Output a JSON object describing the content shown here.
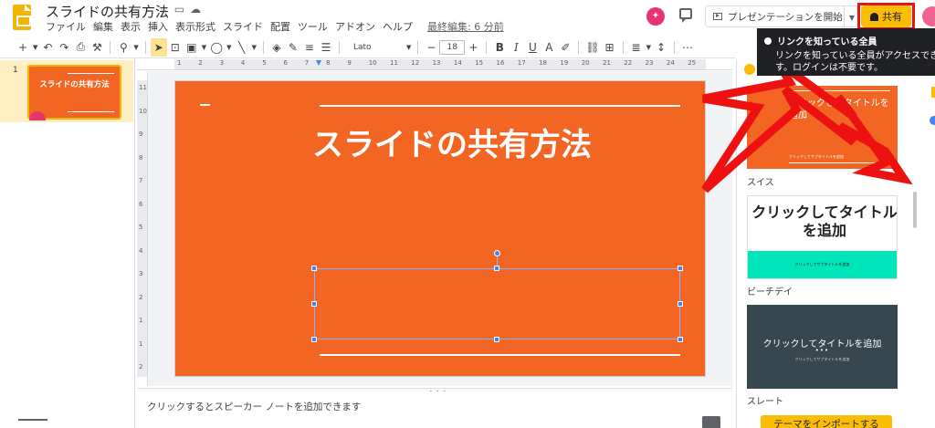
{
  "header": {
    "doc_title": "スライドの共有方法",
    "title_icons": [
      "star-icon",
      "folder-move-icon",
      "cloud-status-icon"
    ],
    "menus": [
      "ファイル",
      "編集",
      "表示",
      "挿入",
      "表示形式",
      "スライド",
      "配置",
      "ツール",
      "アドオン",
      "ヘルプ"
    ],
    "last_edit": "最終編集: 6 分前",
    "present_label": "プレゼンテーションを開始",
    "share_label": "共有",
    "accent_color": "#fbbc04",
    "highlight_color": "#ee1111"
  },
  "tooltip": {
    "title": "リンクを知っている全員",
    "line1": "リンクを知っている全員がアクセスできま",
    "line2": "す。ログインは不要です。"
  },
  "toolbar": {
    "font_name": "Lato",
    "font_size": "18",
    "more": "⋯"
  },
  "filmstrip": {
    "slides": [
      {
        "number": "1",
        "title": "スライドの共有方法"
      }
    ]
  },
  "ruler": {
    "h_labels": [
      "1",
      "2",
      "3",
      "4",
      "5",
      "6",
      "7",
      "8",
      "9",
      "10",
      "11",
      "12",
      "13",
      "14",
      "15",
      "16",
      "17",
      "18",
      "19",
      "20",
      "21",
      "22",
      "23",
      "24",
      "25"
    ],
    "v_labels": [
      "11",
      "10",
      "9",
      "8",
      "7",
      "6",
      "5",
      "4",
      "3",
      "2",
      "1",
      "1",
      "2"
    ]
  },
  "slide": {
    "title": "スライドの共有方法",
    "background": "#f36523"
  },
  "notes": {
    "placeholder": "クリックするとスピーカー ノートを追加できます"
  },
  "themes": {
    "items": [
      {
        "name": "スイス",
        "title": "クリックしてタイトルを追加",
        "subtitle": "クリックしてサブタイトルを追加"
      },
      {
        "name": "ビーチデイ",
        "title": "クリックしてタイトルを追加",
        "subtitle": "クリックしてサブタイトルを追加"
      },
      {
        "name": "スレート",
        "title": "クリックしてタイトルを追加",
        "subtitle": "クリックしてサブタイトルを追加"
      }
    ],
    "import_label": "テーマをインポートする"
  }
}
